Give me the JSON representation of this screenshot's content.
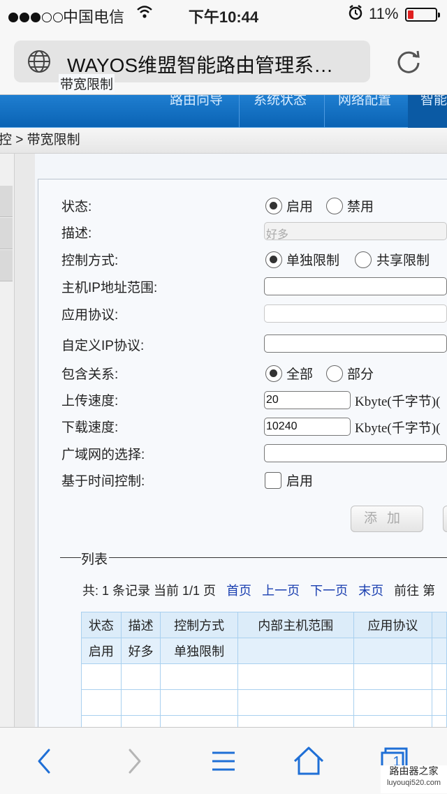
{
  "status_bar": {
    "carrier": "中国电信",
    "time": "下午10:44",
    "battery_percent": "11%",
    "battery_level": 0.11,
    "signal_bars": 3
  },
  "address_bar": {
    "title": "WAYOS维盟智能路由管理系…"
  },
  "top_nav": {
    "items": [
      "路由向导",
      "系统状态",
      "网络配置",
      "智能"
    ]
  },
  "breadcrumb": "控 > 带宽限制",
  "form": {
    "legend": "带宽限制",
    "status_label": "状态:",
    "status_enable": "启用",
    "status_disable": "禁用",
    "desc_label": "描述:",
    "desc_value": "好多",
    "control_label": "控制方式:",
    "control_individual": "单独限制",
    "control_shared": "共享限制",
    "host_ip_label": "主机IP地址范围:",
    "host_ip_value": "",
    "app_proto_label": "应用协议:",
    "app_proto_value": "",
    "custom_ip_label": "自定义IP协议:",
    "custom_ip_value": "",
    "include_label": "包含关系:",
    "include_all": "全部",
    "include_partial": "部分",
    "upload_label": "上传速度:",
    "upload_value": "20",
    "upload_unit": "Kbyte(千字节)(",
    "download_label": "下载速度:",
    "download_value": "10240",
    "download_unit": "Kbyte(千字节)(",
    "wan_label": "广域网的选择:",
    "wan_value": "",
    "time_control_label": "基于时间控制:",
    "time_control_enable": "启用",
    "add_button": "添加"
  },
  "list": {
    "legend": "列表",
    "pager": {
      "summary": "共: 1 条记录 当前 1/1 页",
      "first": "首页",
      "prev": "上一页",
      "next": "下一页",
      "last": "末页",
      "goto": "前往 第"
    },
    "columns": [
      "状态",
      "描述",
      "控制方式",
      "内部主机范围",
      "应用协议"
    ],
    "rows": [
      [
        "启用",
        "好多",
        "单独限制",
        "",
        ""
      ]
    ]
  },
  "watermark": {
    "line1": "路由器之家",
    "line2": "luyouqi520.com"
  },
  "toolbar": {
    "tabs_count": "1"
  },
  "icons": [
    "globe-icon",
    "reload-icon",
    "back-icon",
    "forward-icon",
    "menu-icon",
    "home-icon",
    "tabs-icon",
    "wifi-icon",
    "alarm-icon"
  ],
  "colors": {
    "nav_blue": "#0a63b4",
    "link_blue": "#1a3fb0",
    "battery_red": "#e02020",
    "table_header": "#dcecf9"
  }
}
